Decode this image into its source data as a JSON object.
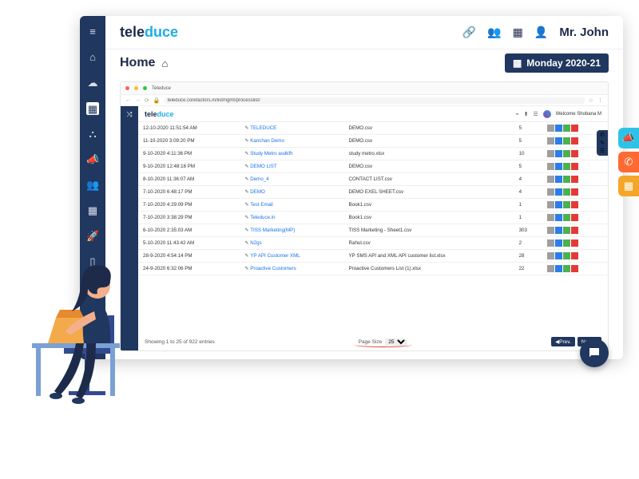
{
  "outer": {
    "brand1": "tele",
    "brand2": "duce",
    "user": "Mr. John",
    "home": "Home",
    "date": "Monday 2020-21"
  },
  "inner": {
    "url": "teleduce.corefactors.in/listmgmt/processlist/",
    "welcome": "Welcome Shobana M",
    "footer_text": "Showing 1 to 25 of 922 entries",
    "page_size_label": "Page Size",
    "page_size_value": "25",
    "prev": "◀Prev.",
    "next": "Next ▶"
  },
  "rows": [
    {
      "date": "12-10-2020 11:51:54 AM",
      "name": "TELEDUCE",
      "file": "DEMO.csv",
      "count": "5"
    },
    {
      "date": "11-10-2020 3:09:20 PM",
      "name": "Kanchan Demo",
      "file": "DEMO.csv",
      "count": "5"
    },
    {
      "date": "9-10-2020 4:11:36 PM",
      "name": "Study Metro asdkfh",
      "file": "study metro.xlsx",
      "count": "10"
    },
    {
      "date": "9-10-2020 12:48:16 PM",
      "name": "DEMO LIST",
      "file": "DEMO.csv",
      "count": "5"
    },
    {
      "date": "8-10-2020 11:36:07 AM",
      "name": "Demo_4",
      "file": "CONTACT LIST.csv",
      "count": "4"
    },
    {
      "date": "7-10-2020 6:48:17 PM",
      "name": "DEMO",
      "file": "DEMO EXEL SHEET.csv",
      "count": "4"
    },
    {
      "date": "7-10-2020 4:29:09 PM",
      "name": "Test Email",
      "file": "Book1.csv",
      "count": "1"
    },
    {
      "date": "7-10-2020 3:38:29 PM",
      "name": "Teleduce.in",
      "file": "Book1.csv",
      "count": "1"
    },
    {
      "date": "6-10-2020 2:35:03 AM",
      "name": "TISS Marketing(MP)",
      "file": "TISS Marketing - Sheet1.csv",
      "count": "303"
    },
    {
      "date": "5-10-2020 11:43:42 AM",
      "name": "N2gs",
      "file": "Rahul.csv",
      "count": "2"
    },
    {
      "date": "28-9-2020 4:54:14 PM",
      "name": "YP API Customer XML",
      "file": "YP SMS API and XML API customer list.xlsx",
      "count": "28"
    },
    {
      "date": "24-9-2020 6:32:06 PM",
      "name": "Proactive Customers",
      "file": "Proactive Customers List (1).xlsx",
      "count": "22"
    }
  ]
}
